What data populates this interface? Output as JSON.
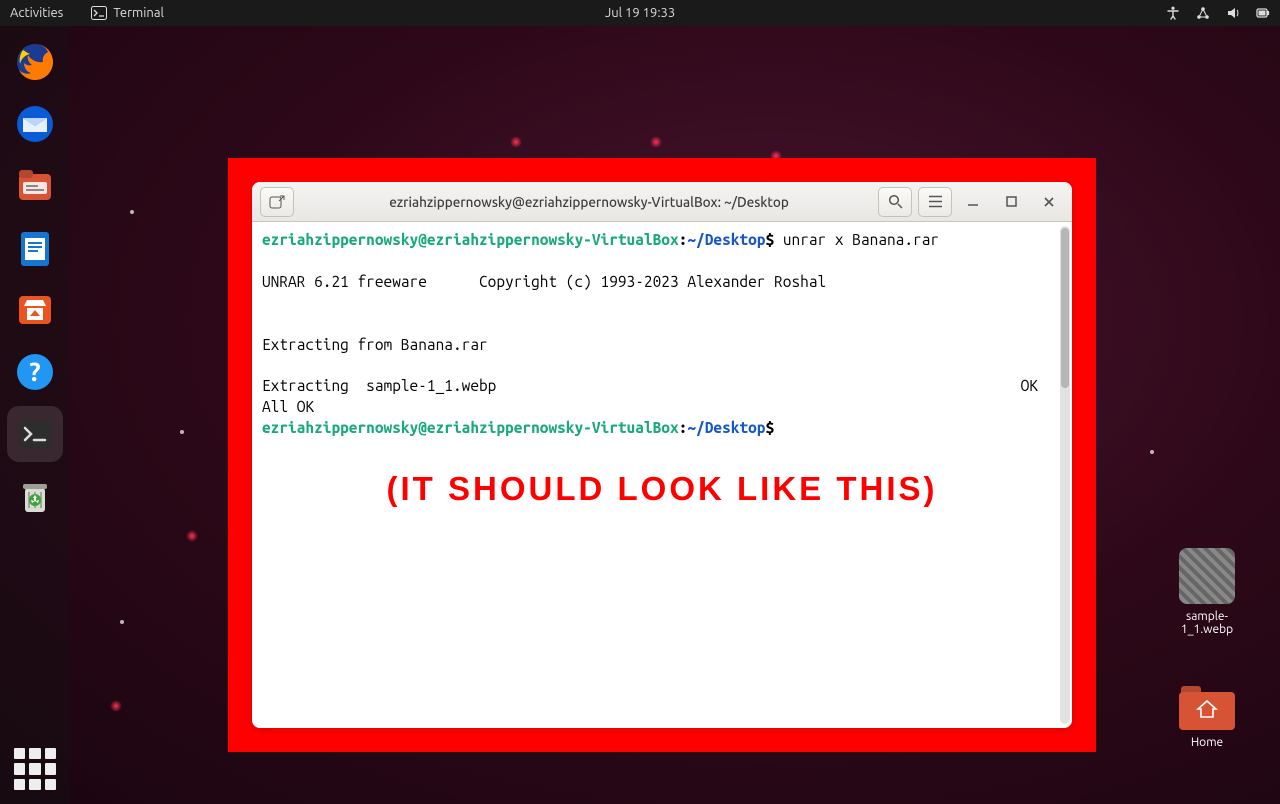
{
  "topbar": {
    "activities": "Activities",
    "app_name": "Terminal",
    "clock": "Jul 19  19:33"
  },
  "dock": {
    "items": [
      {
        "name": "firefox"
      },
      {
        "name": "thunderbird"
      },
      {
        "name": "files"
      },
      {
        "name": "libreoffice-writer"
      },
      {
        "name": "ubuntu-software"
      },
      {
        "name": "help"
      },
      {
        "name": "terminal",
        "active": true
      },
      {
        "name": "trash"
      }
    ]
  },
  "desktop_icons": {
    "file1": {
      "label": "sample-1_1.webp"
    },
    "home": {
      "label": "Home"
    }
  },
  "terminal": {
    "title": "ezriahzippernowsky@ezriahzippernowsky-VirtualBox: ~/Desktop",
    "prompt_user": "ezriahzippernowsky@ezriahzippernowsky-VirtualBox",
    "prompt_sep1": ":",
    "prompt_path": "~/Desktop",
    "prompt_sep2": "$",
    "command": " unrar x Banana.rar",
    "line_unrar": "UNRAR 6.21 freeware      Copyright (c) 1993-2023 Alexander Roshal",
    "line_extract_from": "Extracting from Banana.rar",
    "line_extract_file": "Extracting  sample-1_1.webp",
    "line_ok": "OK",
    "line_all_ok": "All OK"
  },
  "annotation": "(IT SHOULD LOOK LIKE THIS)"
}
